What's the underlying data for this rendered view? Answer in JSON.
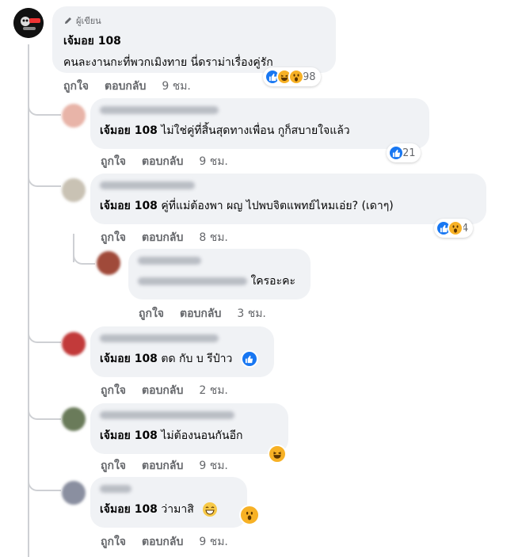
{
  "post_author_badge": "ผู้เขียน",
  "actions": {
    "like": "ถูกใจ",
    "reply": "ตอบกลับ"
  },
  "main_comment": {
    "author": "เจ้มอย 108",
    "text": "คนละงานกะที่พวกเมิงทาย นี่ดราม่าเรื่องคู่รัก",
    "time": "9 ชม.",
    "reaction_count": "98",
    "reactions": [
      "like",
      "haha",
      "wow"
    ]
  },
  "replies": [
    {
      "author": "เจ้มอย 108",
      "text": "ไม่ใช่คู่ที่สิ้นสุดทางเพื่อน กูก็สบายใจแล้ว",
      "time": "9 ชม.",
      "reaction_count": "21",
      "reactions": [
        "like"
      ]
    },
    {
      "author": "เจ้มอย 108",
      "text": "คู่ที่แม่ต้องพา ผญ ไปพบจิตแพทย์ไหมเอ่ย? (เดาๆ)",
      "time": "8 ชม.",
      "reaction_count": "4",
      "reactions": [
        "like",
        "wow"
      ]
    },
    {
      "author": "",
      "text": "ใครอะคะ",
      "time": "3 ชม.",
      "reaction_count": "",
      "reactions": []
    },
    {
      "author": "เจ้มอย 108",
      "text": "ตด กับ บ รีป๋าว",
      "time": "2 ชม.",
      "reaction_count": "",
      "reactions": [
        "like"
      ]
    },
    {
      "author": "เจ้มอย 108",
      "text": "ไม่ต้องนอนกันอีก",
      "time": "9 ชม.",
      "reaction_count": "",
      "reactions": [
        "haha"
      ]
    },
    {
      "author": "เจ้มอย 108",
      "text": "ว่ามาสิ",
      "time": "9 ชม.",
      "reaction_count": "",
      "reactions": [
        "grin-emoji",
        "wow"
      ]
    }
  ],
  "colors": {
    "bubble": "#f0f2f5",
    "like_blue": "#1877f2",
    "emoji_yellow": "#f7b125",
    "meta_gray": "#65676b"
  }
}
